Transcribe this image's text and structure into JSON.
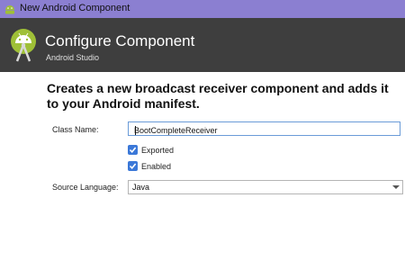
{
  "window": {
    "title": "New Android Component"
  },
  "header": {
    "title": "Configure Component",
    "subtitle": "Android Studio"
  },
  "description": "Creates a new broadcast receiver component and adds it to your Android manifest.",
  "form": {
    "class_name": {
      "label": "Class Name:",
      "value": "BootCompleteReceiver"
    },
    "exported": {
      "label": "Exported",
      "checked": true
    },
    "enabled": {
      "label": "Enabled",
      "checked": true
    },
    "source_language": {
      "label": "Source Language:",
      "selected": "Java"
    }
  },
  "colors": {
    "titlebar": "#8b7fd1",
    "header": "#3e3e3e",
    "checkbox": "#3b78d8",
    "android": "#9fc037"
  },
  "icons": {
    "window": "android-icon",
    "logo": "android-studio-logo-icon"
  }
}
